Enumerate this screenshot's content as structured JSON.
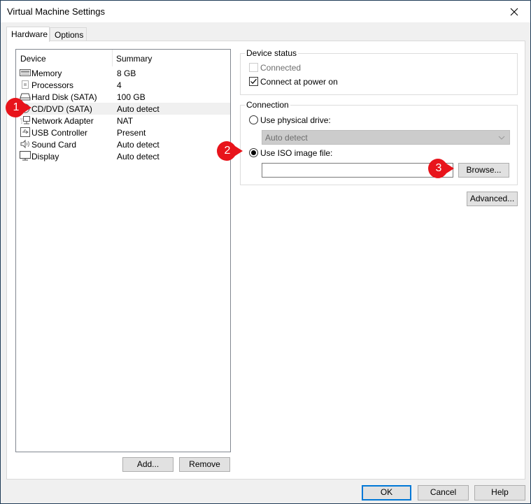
{
  "window": {
    "title": "Virtual Machine Settings",
    "close_icon": "close-icon"
  },
  "tabs": [
    {
      "label": "Hardware",
      "active": true
    },
    {
      "label": "Options",
      "active": false
    }
  ],
  "device_list": {
    "columns": {
      "device": "Device",
      "summary": "Summary"
    },
    "rows": [
      {
        "name": "Memory",
        "summary": "8 GB",
        "icon": "memory-icon",
        "selected": false
      },
      {
        "name": "Processors",
        "summary": "4",
        "icon": "processor-icon",
        "selected": false
      },
      {
        "name": "Hard Disk (SATA)",
        "summary": "100 GB",
        "icon": "hard-disk-icon",
        "selected": false
      },
      {
        "name": "CD/DVD (SATA)",
        "summary": "Auto detect",
        "icon": "cd-dvd-icon",
        "selected": true
      },
      {
        "name": "Network Adapter",
        "summary": "NAT",
        "icon": "network-adapter-icon",
        "selected": false
      },
      {
        "name": "USB Controller",
        "summary": "Present",
        "icon": "usb-icon",
        "selected": false
      },
      {
        "name": "Sound Card",
        "summary": "Auto detect",
        "icon": "speaker-icon",
        "selected": false
      },
      {
        "name": "Display",
        "summary": "Auto detect",
        "icon": "monitor-icon",
        "selected": false
      }
    ],
    "add_label": "Add...",
    "remove_label": "Remove"
  },
  "device_status": {
    "label": "Device status",
    "connected_label": "Connected",
    "connected_checked": false,
    "connected_enabled": false,
    "connect_power_on_label": "Connect at power on",
    "connect_power_on_checked": true
  },
  "connection": {
    "label": "Connection",
    "physical_drive_label": "Use physical drive:",
    "physical_drive_selected": false,
    "physical_drive_value": "Auto detect",
    "iso_label": "Use ISO image file:",
    "iso_selected": true,
    "iso_path": "",
    "browse_label": "Browse..."
  },
  "advanced_label": "Advanced...",
  "footer": {
    "ok_label": "OK",
    "cancel_label": "Cancel",
    "help_label": "Help"
  },
  "callouts": [
    "1",
    "2",
    "3"
  ],
  "colors": {
    "callout_red": "#e8141b",
    "default_button_border": "#0078d7"
  }
}
